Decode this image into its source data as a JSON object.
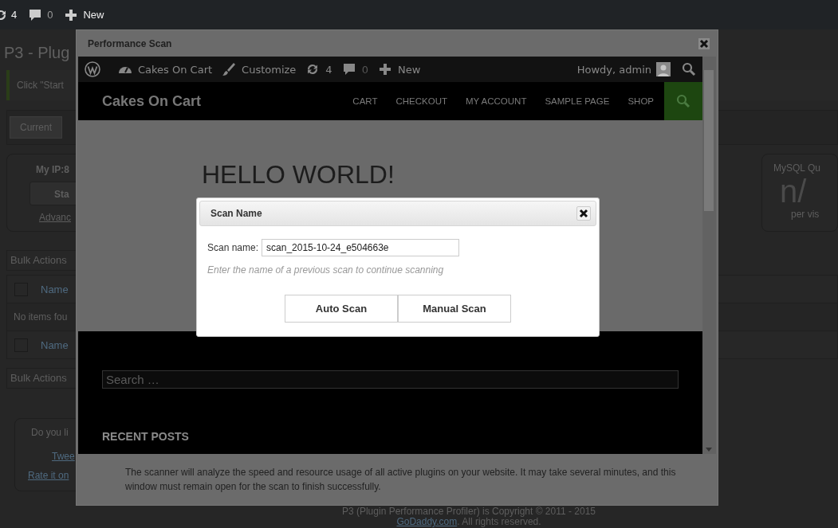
{
  "admin_bar": {
    "updates": "4",
    "comments": "0",
    "new": "New"
  },
  "page": {
    "title": "P3 - Plug",
    "notice": "Click \"Start",
    "tabs": [
      {
        "label": "Current",
        "selected": true
      }
    ],
    "ip_card": {
      "label": "My IP:8",
      "button": "Sta",
      "link": "Advanc"
    },
    "bulk_actions_top": "Bulk Actions",
    "table": {
      "header": {
        "label": "Name",
        "checked": false
      },
      "empty": "No items fou",
      "footer": {
        "label": "Name",
        "checked": false
      }
    },
    "bulk_actions_bottom": "Bulk Actions",
    "share": {
      "question": "Do you li",
      "tweet": "Twee",
      "rate": "Rate it on"
    },
    "mysql_card": {
      "label": "MySQL Qu",
      "value": "n/",
      "unit": "per vis"
    },
    "footer": {
      "copyright": "P3 (Plugin Performance Profiler) is Copyright © 2011 - 2015",
      "link": "GoDaddy.com",
      "rights": ". All rights reserved."
    }
  },
  "modal": {
    "title": "Performance Scan",
    "site": {
      "admin_bar": {
        "site_name": "Cakes On Cart",
        "customize": "Customize",
        "updates": "4",
        "comments": "0",
        "new": "New",
        "greeting": "Howdy, admin"
      },
      "brand": "Cakes On Cart",
      "menu": [
        "CART",
        "CHECKOUT",
        "MY ACCOUNT",
        "SAMPLE PAGE",
        "SHOP"
      ],
      "heading": "HELLO WORLD!",
      "search": {
        "placeholder": "Search …"
      },
      "recent_posts": "RECENT POSTS"
    },
    "description": "The scanner will analyze the speed and resource usage of all active plugins on your website. It may take several minutes, and this window must remain open for the scan to finish successfully."
  },
  "dialog": {
    "title": "Scan Name",
    "label": "Scan name:",
    "value": "scan_2015-10-24_e504663e",
    "hint": "Enter the name of a previous scan to continue scanning",
    "buttons": [
      "Auto Scan",
      "Manual Scan"
    ]
  }
}
